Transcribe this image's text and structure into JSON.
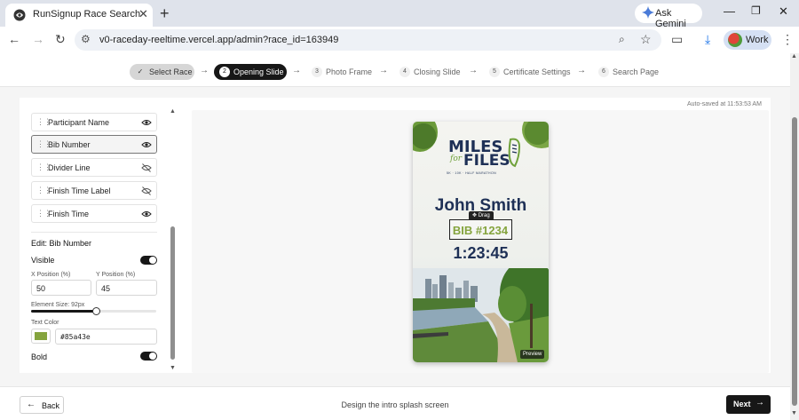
{
  "browser": {
    "tab_title": "RunSignup Race Search",
    "new_tab_icon": "plus-icon",
    "gemini_label": "Ask Gemini",
    "url": "v0-raceday-reeltime.vercel.app/admin?race_id=163949",
    "profile_label": "Work"
  },
  "steps": [
    {
      "num": "✓",
      "label": "Select Race",
      "state": "done"
    },
    {
      "num": "2",
      "label": "Opening Slide",
      "state": "active"
    },
    {
      "num": "3",
      "label": "Photo Frame",
      "state": "todo"
    },
    {
      "num": "4",
      "label": "Closing Slide",
      "state": "todo"
    },
    {
      "num": "5",
      "label": "Certificate Settings",
      "state": "todo"
    },
    {
      "num": "6",
      "label": "Search Page",
      "state": "todo"
    }
  ],
  "elements": [
    {
      "label": "Participant Name",
      "visible": true
    },
    {
      "label": "Bib Number",
      "visible": true,
      "selected": true
    },
    {
      "label": "Divider Line",
      "visible": false
    },
    {
      "label": "Finish Time Label",
      "visible": false
    },
    {
      "label": "Finish Time",
      "visible": true
    }
  ],
  "editor": {
    "title": "Edit: Bib Number",
    "visible_label": "Visible",
    "visible_on": true,
    "x_label": "X Position (%)",
    "x_value": "50",
    "y_label": "Y Position (%)",
    "y_value": "45",
    "size_label": "Element Size: 92px",
    "size_fraction": 0.52,
    "color_label": "Text Color",
    "color_value": "#85a43e",
    "bold_label": "Bold",
    "bold_on": true
  },
  "autosave": "Auto-saved at 11:53:53 AM",
  "preview": {
    "logo_top": "MILES",
    "logo_for": "for",
    "logo_bottom": "FILES",
    "logo_tagline": "5K · 10K · HALF MARATHON",
    "participant_name": "John Smith",
    "drag_label": "Drag",
    "bib": "BIB #1234",
    "finish_time": "1:23:45",
    "badge": "Preview",
    "navy": "#1e3056",
    "accent": "#85a43e"
  },
  "footer": {
    "back_label": "Back",
    "hint": "Design the intro splash screen",
    "next_label": "Next"
  }
}
